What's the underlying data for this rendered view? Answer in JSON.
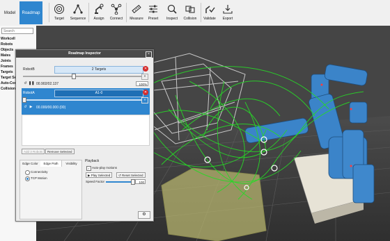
{
  "toolbar": {
    "tabs": [
      {
        "label": "Model",
        "active": false
      },
      {
        "label": "Roadmap",
        "active": true
      }
    ],
    "buttons": [
      {
        "label": "Target",
        "icon": "target-icon"
      },
      {
        "label": "Sequence",
        "icon": "sequence-icon"
      },
      {
        "label": "Assign",
        "icon": "assign-icon"
      },
      {
        "label": "Connect",
        "icon": "connect-icon"
      },
      {
        "label": "Measure",
        "icon": "measure-icon"
      },
      {
        "label": "Preset",
        "icon": "preset-icon"
      },
      {
        "label": "Inspect",
        "icon": "inspect-icon"
      },
      {
        "label": "Collision",
        "icon": "collision-icon"
      },
      {
        "label": "Validate",
        "icon": "validate-icon"
      },
      {
        "label": "Export",
        "icon": "export-icon"
      }
    ]
  },
  "sidebar": {
    "search_placeholder": "Search",
    "items": [
      "Workcell",
      "Robots",
      "Objects",
      "Mates",
      "Joints",
      "Frames",
      "Targets",
      "Target Se",
      "Auto-Con",
      "Collision"
    ]
  },
  "dialog": {
    "title": "Roadmap Inspector",
    "close": "×",
    "robots": [
      {
        "name": "RobotB",
        "targets": "2 Targets",
        "time": "00.902/02.137",
        "percent": "100%",
        "progress": 0.42,
        "selected": false
      },
      {
        "name": "RobotA",
        "targets": "A1-0",
        "time": "00.000/00.000 (00)",
        "percent": "100%",
        "progress": 0.0,
        "selected": true
      }
    ],
    "add_button": "Add 3 Robots",
    "remove_button": "Remove Selected",
    "tabs": [
      "Edge Color",
      "Edge Path",
      "Visibility"
    ],
    "active_tab": "Edge Path",
    "radio_options": [
      {
        "label": "Connectivity",
        "selected": false
      },
      {
        "label": "TCP Motion",
        "selected": true
      }
    ],
    "playback": {
      "heading": "Playback",
      "auto_play": "Auto-play motions",
      "auto_play_checked": true,
      "play_selected": "Play Selected",
      "reset_selected": "Reset Selected",
      "speed_label": "Speed Factor",
      "speed_value": "100",
      "speed_fraction": 1.0
    }
  },
  "colors": {
    "accent": "#2f86cf",
    "path_green": "#27d827",
    "robot_blue": "#3b84c9",
    "part_yellow": "#b7b46f"
  }
}
